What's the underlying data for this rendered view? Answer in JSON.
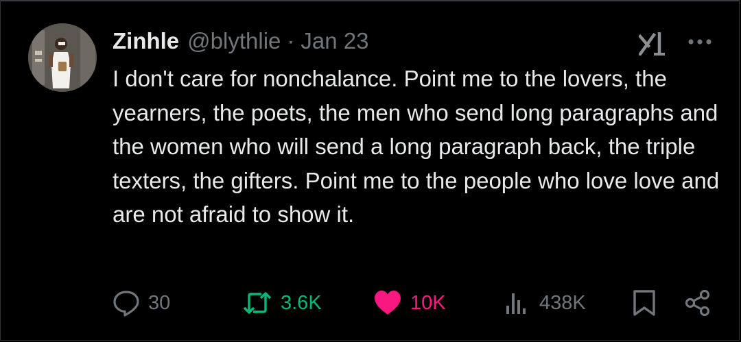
{
  "author": {
    "name": "Zinhle",
    "handle": "@blythlie",
    "separator": "·",
    "date": "Jan 23"
  },
  "tweet": {
    "text": "I don't care for nonchalance. Point me to the lovers, the yearners, the poets, the men who send long paragraphs and the women who will send a long paragraph back, the triple texters, the gifters. Point me to the people who love love and are not afraid to show it."
  },
  "actions": {
    "replies": "30",
    "reposts": "3.6K",
    "likes": "10K",
    "views": "438K"
  },
  "icons": {
    "reply": "reply-icon",
    "repost": "repost-icon",
    "like": "heart-icon",
    "views": "views-icon",
    "bookmark": "bookmark-icon",
    "share": "share-icon",
    "grok": "grok-icon",
    "more": "more-icon"
  },
  "colors": {
    "background": "#000000",
    "text": "#e7e9ea",
    "muted": "#71767b",
    "repost": "#00ba7c",
    "like": "#f91880"
  }
}
